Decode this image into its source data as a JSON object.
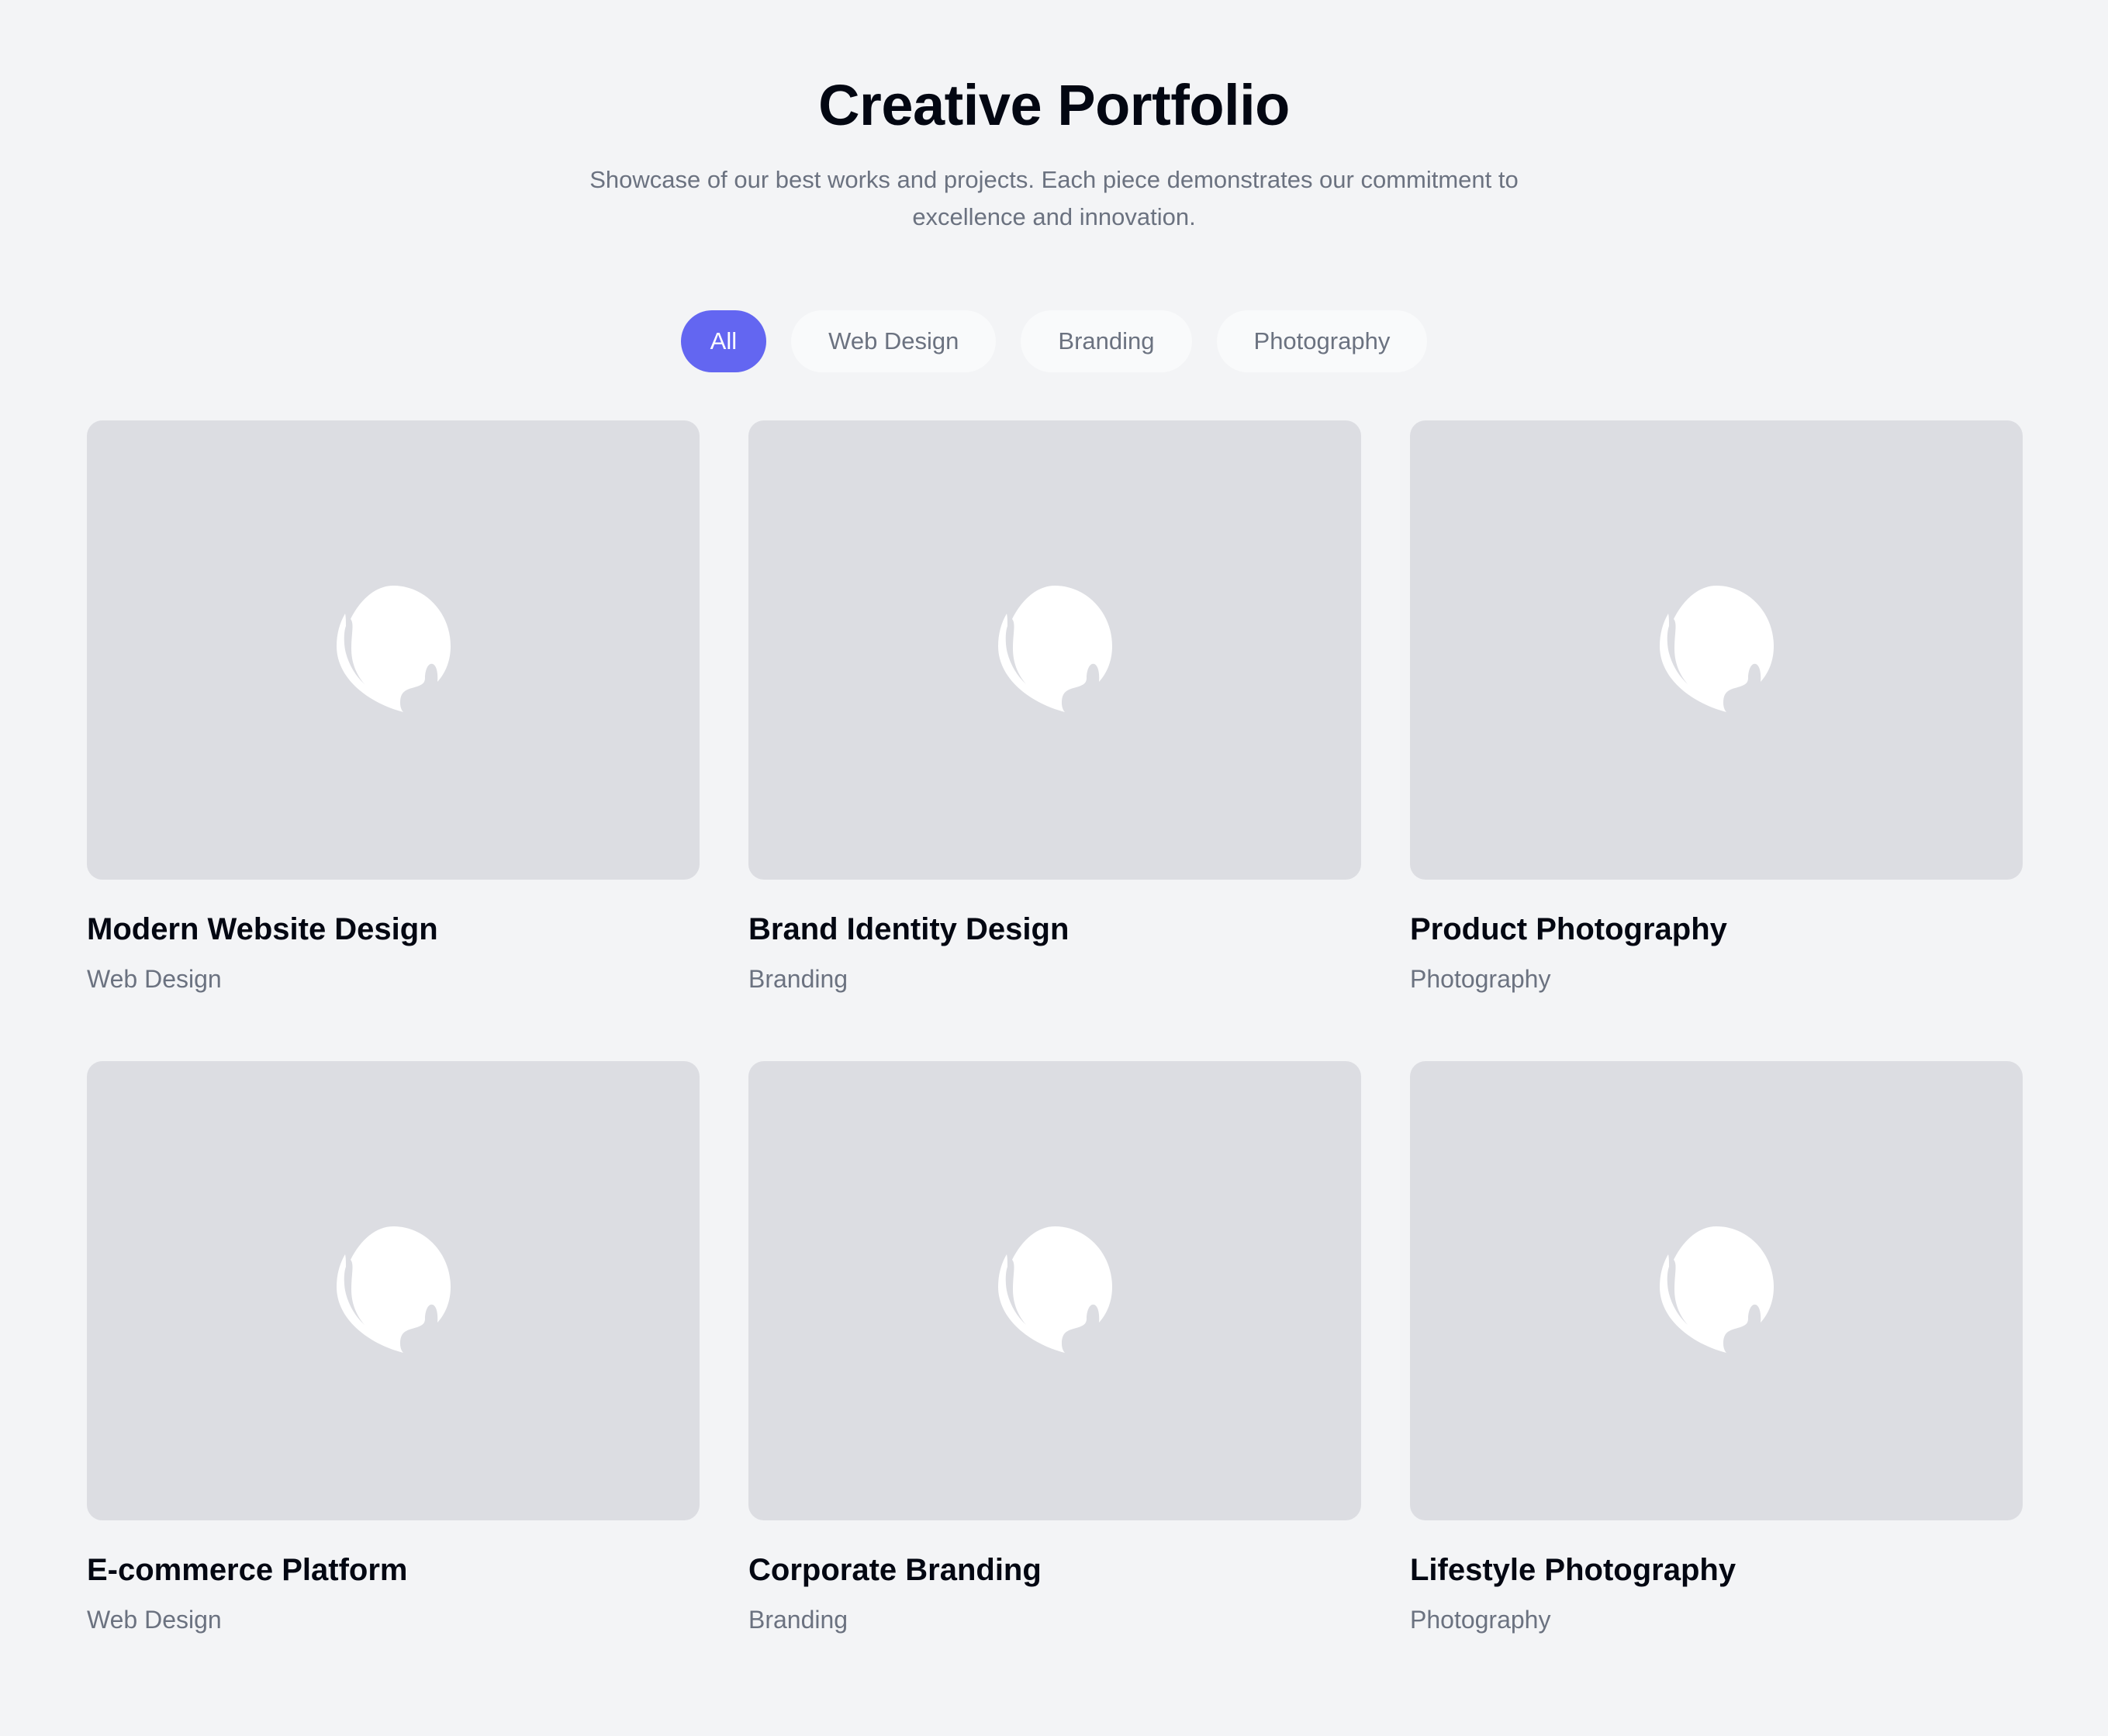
{
  "header": {
    "title": "Creative Portfolio",
    "subtitle": "Showcase of our best works and projects. Each piece demonstrates our commitment to excellence and innovation."
  },
  "filters": [
    {
      "label": "All",
      "active": true
    },
    {
      "label": "Web Design",
      "active": false
    },
    {
      "label": "Branding",
      "active": false
    },
    {
      "label": "Photography",
      "active": false
    }
  ],
  "projects": [
    {
      "title": "Modern Website Design",
      "category": "Web Design",
      "icon": "image-placeholder-icon"
    },
    {
      "title": "Brand Identity Design",
      "category": "Branding",
      "icon": "image-placeholder-icon"
    },
    {
      "title": "Product Photography",
      "category": "Photography",
      "icon": "image-placeholder-icon"
    },
    {
      "title": "E-commerce Platform",
      "category": "Web Design",
      "icon": "image-placeholder-icon"
    },
    {
      "title": "Corporate Branding",
      "category": "Branding",
      "icon": "image-placeholder-icon"
    },
    {
      "title": "Lifestyle Photography",
      "category": "Photography",
      "icon": "image-placeholder-icon"
    }
  ],
  "colors": {
    "background": "#f3f4f6",
    "accent": "#6366f1",
    "thumbnail": "#dcdde2",
    "muted_text": "#6b7280",
    "heading_text": "#030712"
  }
}
